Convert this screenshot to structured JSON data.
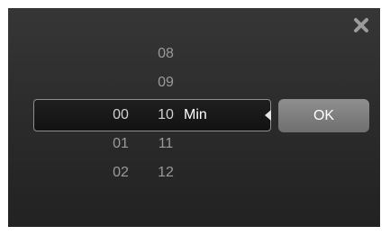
{
  "close_icon": "close-icon",
  "hours": {
    "above": [
      "",
      ""
    ],
    "selected": "00",
    "below": [
      "01",
      "02"
    ]
  },
  "minutes": {
    "above": [
      "08",
      "09"
    ],
    "selected": "10",
    "below": [
      "11",
      "12"
    ]
  },
  "unit_label": "Min",
  "ok_label": "OK",
  "colors": {
    "dialog_bg": "#2b2b2b",
    "text_dim": "#9a9a9a",
    "text_selected": "#ffffff",
    "button_bg": "#7f7f7f"
  }
}
